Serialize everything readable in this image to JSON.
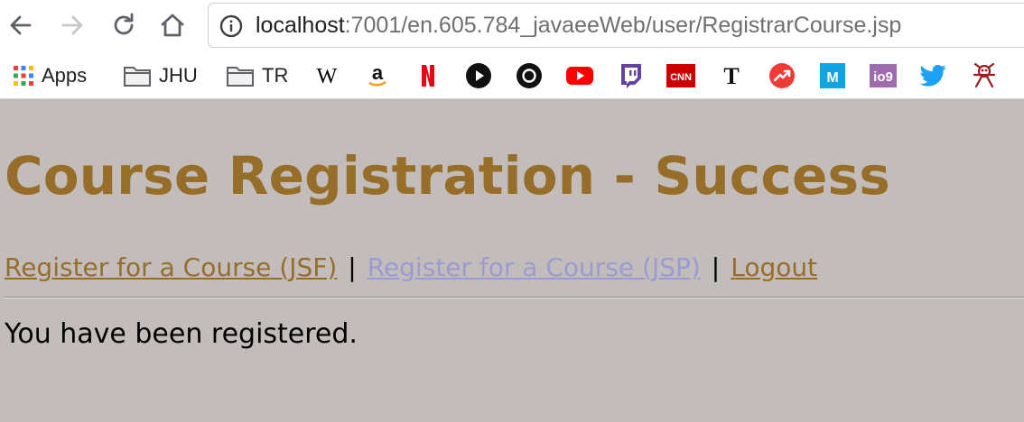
{
  "browser": {
    "url_host": "localhost",
    "url_path": ":7001/en.605.784_javaeeWeb/user/RegistrarCourse.jsp"
  },
  "bookmarks": [
    {
      "label": "Apps",
      "icon": "apps-grid-icon"
    },
    {
      "label": "JHU",
      "icon": "folder-icon"
    },
    {
      "label": "TR",
      "icon": "folder-icon"
    }
  ],
  "favicons": [
    "wikipedia",
    "amazon",
    "netflix",
    "play",
    "circle",
    "youtube",
    "twitch",
    "cnn",
    "nytimes",
    "trending",
    "medium",
    "io9",
    "twitter",
    "bug"
  ],
  "page": {
    "heading": "Course Registration - Success",
    "links": {
      "jsf": "Register for a Course (JSF)",
      "jsp": "Register for a Course (JSP)",
      "logout": "Logout",
      "separator": "|"
    },
    "message": "You have been registered."
  },
  "colors": {
    "heading": "#976d2a",
    "link": "#976d2a",
    "visited_link": "#9b9bd2",
    "background": "#c2bdbb"
  }
}
